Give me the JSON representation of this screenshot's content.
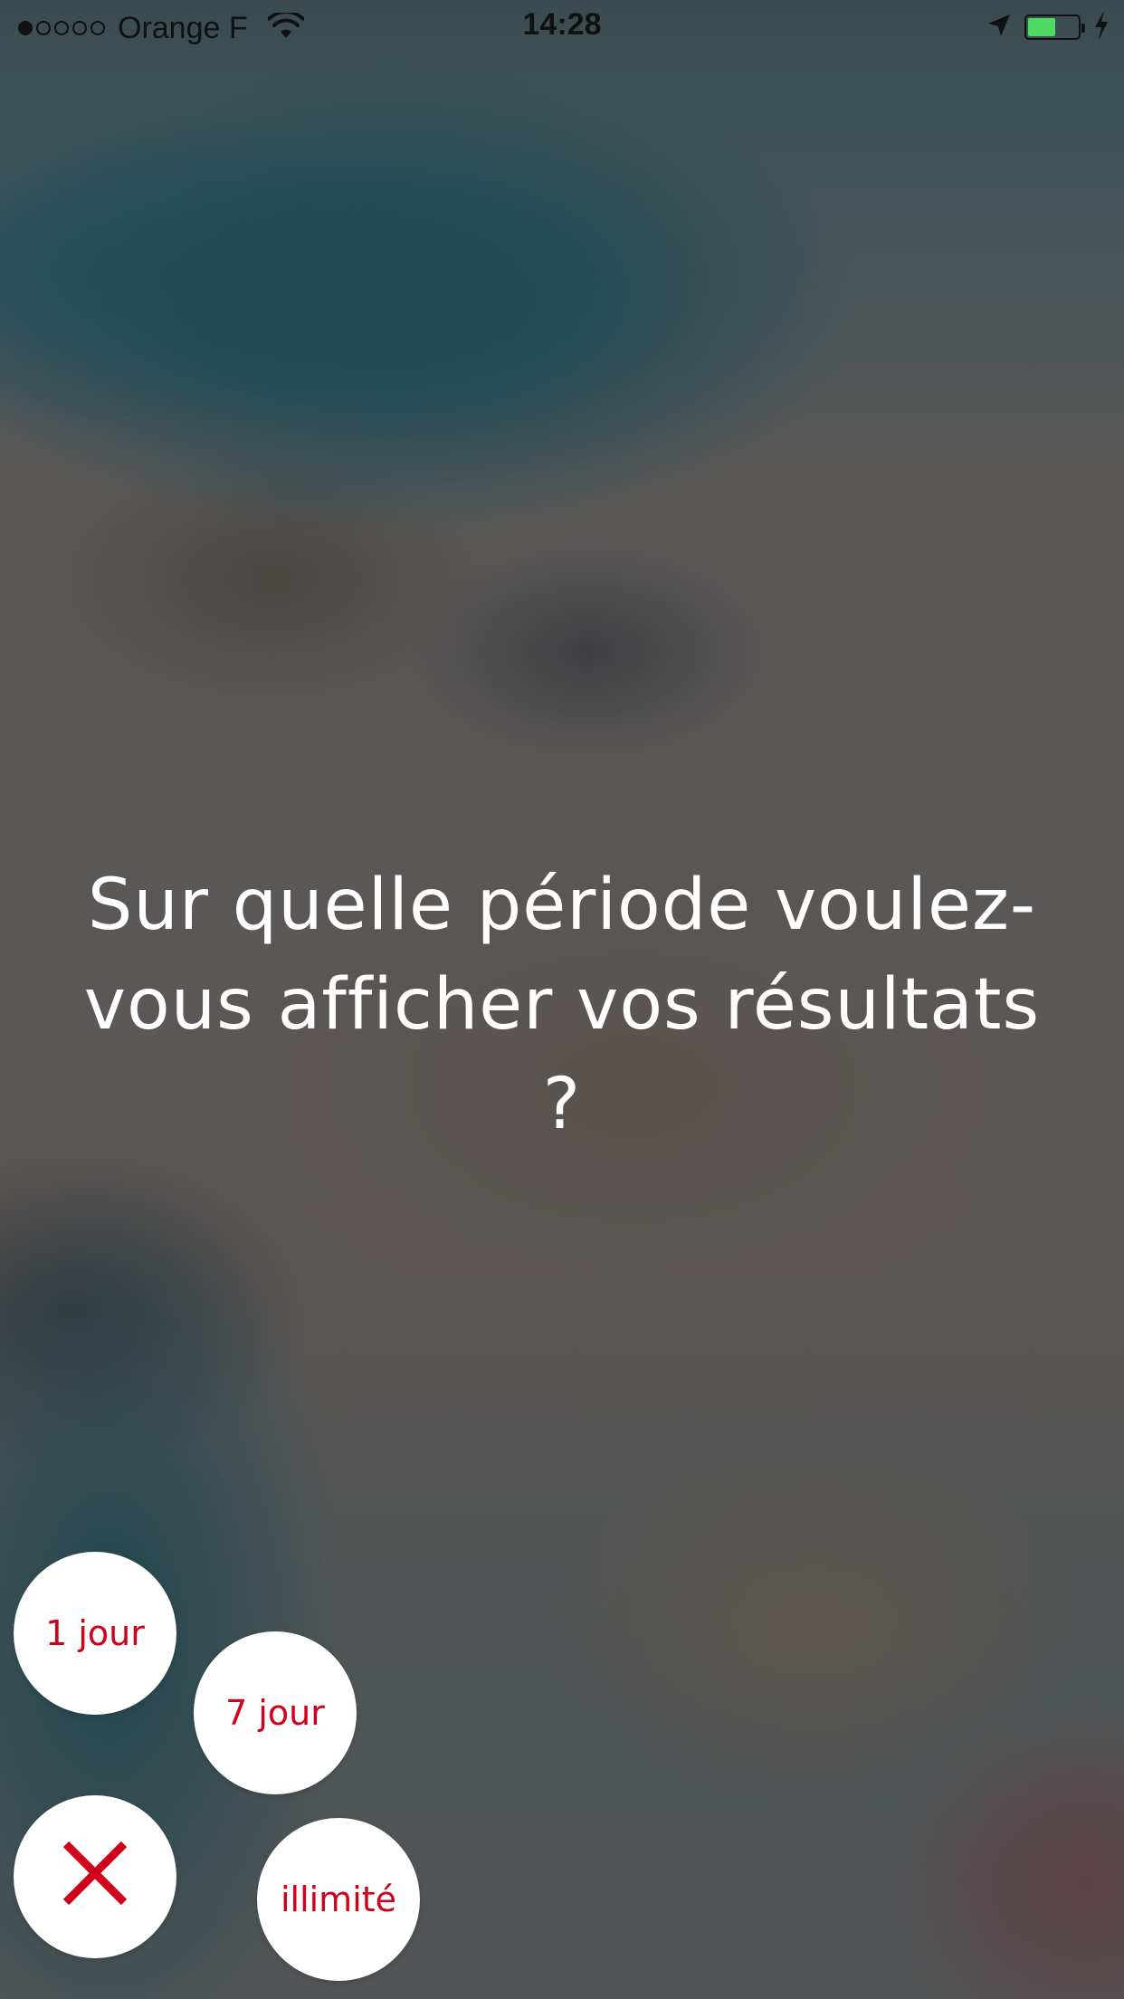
{
  "status_bar": {
    "signal_bars_filled": 1,
    "signal_bars_total": 5,
    "carrier": "Orange F",
    "time": "14:28",
    "icons": [
      "wifi-icon",
      "location-arrow-icon",
      "battery-icon",
      "charging-bolt-icon"
    ],
    "battery_level": 0.55,
    "battery_color": "#4cd964"
  },
  "question": {
    "text": "Sur quelle période voulez-vous afficher vos résultats ?"
  },
  "options": {
    "one_day": "1 jour",
    "seven_day": "7 jour",
    "unlimited": "illimité",
    "close_icon": "close-x-icon"
  },
  "colors": {
    "accent": "#d0021b",
    "button_bg": "#ffffff",
    "text": "#ffffff"
  }
}
